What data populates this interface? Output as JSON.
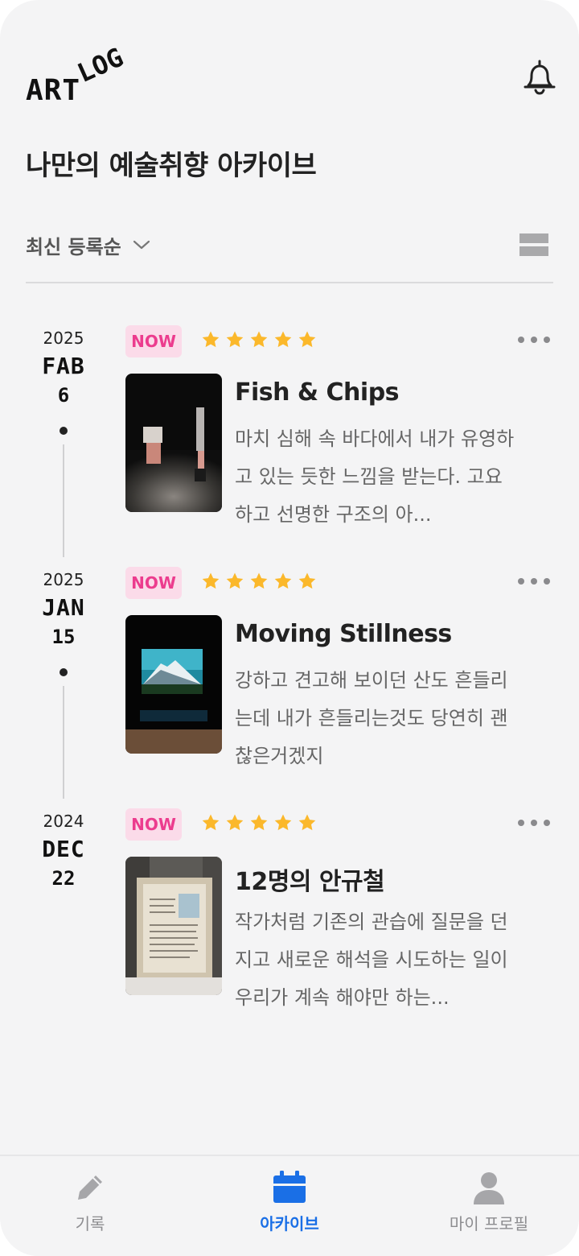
{
  "header": {
    "logo_part1": "ART",
    "logo_part2": "LOG",
    "title": "나만의 예술취향 아카이브"
  },
  "sort": {
    "label": "최신 등록순"
  },
  "entries": [
    {
      "year": "2025",
      "month": "FAB",
      "day": "6",
      "badge": "NOW",
      "rating": 5,
      "title": "Fish & Chips",
      "description": "마치 심해 속 바다에서 내가 유영하고 있는 듯한 느낌을 받는다. 고요하고 선명한 구조의 아..."
    },
    {
      "year": "2025",
      "month": "JAN",
      "day": "15",
      "badge": "NOW",
      "rating": 5,
      "title": "Moving Stillness",
      "description": "강하고 견고해 보이던 산도 흔들리는데 내가 흔들리는것도 당연히 괜찮은거겠지"
    },
    {
      "year": "2024",
      "month": "DEC",
      "day": "22",
      "badge": "NOW",
      "rating": 5,
      "title": "12명의 안규철",
      "description": "작가처럼 기존의 관습에 질문을 던지고 새로운 해석을 시도하는 일이 우리가 계속 해야만 하는..."
    }
  ],
  "nav": {
    "record": "기록",
    "archive": "아카이브",
    "profile": "마이 프로필"
  },
  "colors": {
    "accent": "#1a6fe6",
    "badge_bg": "#fbdbe9",
    "badge_text": "#ec3c8e",
    "star": "#fbb82b"
  },
  "icons": [
    "bell-icon",
    "chevron-down-icon",
    "list-view-icon",
    "star-icon",
    "more-icon",
    "pencil-icon",
    "calendar-icon",
    "person-icon"
  ]
}
